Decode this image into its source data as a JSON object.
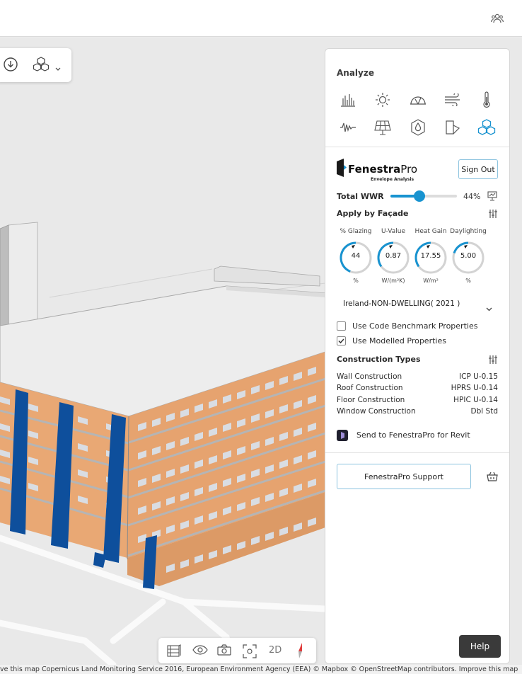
{
  "analyze": {
    "title": "Analyze",
    "tools": [
      "bar-chart-icon",
      "sun-icon",
      "solar-arc-icon",
      "wind-icon",
      "thermometer-icon",
      "waveform-icon",
      "solar-panel-icon",
      "water-drop-icon",
      "facade-icon",
      "cubes-icon"
    ],
    "active_tool": "cubes-icon"
  },
  "fenestra": {
    "brand_bold": "Fenestra",
    "brand_light": "Pro",
    "subtitle": "Envelope Analysis",
    "sign_out": "Sign Out",
    "total_wwr_label": "Total WWR",
    "total_wwr_value": "44%",
    "total_wwr_fraction": 0.44,
    "apply_by_facade": "Apply by Façade",
    "gauges": [
      {
        "title": "% Glazing",
        "value": "44",
        "unit": "%",
        "fill": 0.44
      },
      {
        "title": "U-Value",
        "value": "0.87",
        "unit": "W/(m²K)",
        "fill": 0.35
      },
      {
        "title": "Heat Gain",
        "value": "17.55",
        "unit": "W/m²",
        "fill": 0.35
      },
      {
        "title": "Daylighting",
        "value": "5.00",
        "unit": "%",
        "fill": 0.2
      }
    ],
    "standard": "Ireland-NON-DWELLING( 2021 )",
    "checkboxes": [
      {
        "label": "Use Code Benchmark Properties",
        "checked": false
      },
      {
        "label": "Use Modelled Properties",
        "checked": true
      }
    ],
    "construction_types_label": "Construction Types",
    "construction": [
      {
        "name": "Wall Construction",
        "value": "ICP U-0.15"
      },
      {
        "name": "Roof Construction",
        "value": "HPRS U-0.14"
      },
      {
        "name": "Floor Construction",
        "value": "HPIC U-0.14"
      },
      {
        "name": "Window Construction",
        "value": "Dbl Std"
      }
    ],
    "send_to_revit": "Send to FenestraPro for Revit",
    "support": "FenestraPro Support"
  },
  "help": "Help",
  "bottom_toolbar": {
    "mode_2d": "2D"
  },
  "footer": "ve this map Copernicus Land Monitoring Service 2016, European Environment Agency (EEA) © Mapbox © OpenStreetMap contributors. Improve this map",
  "colors": {
    "accent": "#1893d0",
    "brick": "#e8a777",
    "blue_column": "#0e4f9c",
    "glass": "#d9dde3"
  }
}
